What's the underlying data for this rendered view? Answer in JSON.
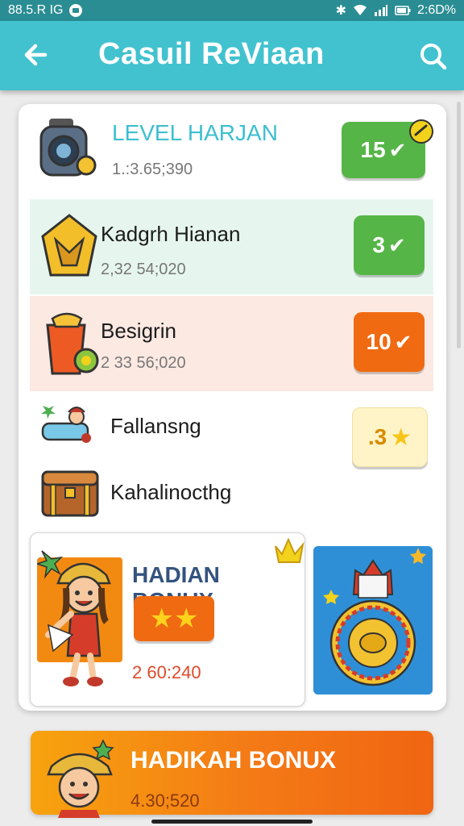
{
  "status_bar": {
    "time": "88.5.R IG",
    "battery_text": "2:6D%"
  },
  "app_bar": {
    "title": "Casuil ReViaan"
  },
  "list": [
    {
      "title": "LEVEL HARJAN",
      "subtitle": "1.:3.65;390",
      "badge": "15"
    },
    {
      "title": "Kadgrh Hianan",
      "subtitle": "2,32 54;020",
      "badge": "3"
    },
    {
      "title": "Besigrin",
      "subtitle": "2 33 56;020",
      "badge": "10"
    },
    {
      "title": "Fallansng",
      "badge": ".3"
    },
    {
      "title": "Kahalinocthg"
    }
  ],
  "bonus_card": {
    "title": "HADIAN BONUX",
    "value": "2 60:240"
  },
  "bottom_banner": {
    "title": "HADIKAH BONUX",
    "value": "4.30;520"
  },
  "colors": {
    "app_bar": "#42c2cf",
    "green_badge": "#56b547",
    "orange_badge": "#f06a12",
    "mint_row": "#e6f6ee",
    "peach_row": "#fce9e2"
  }
}
